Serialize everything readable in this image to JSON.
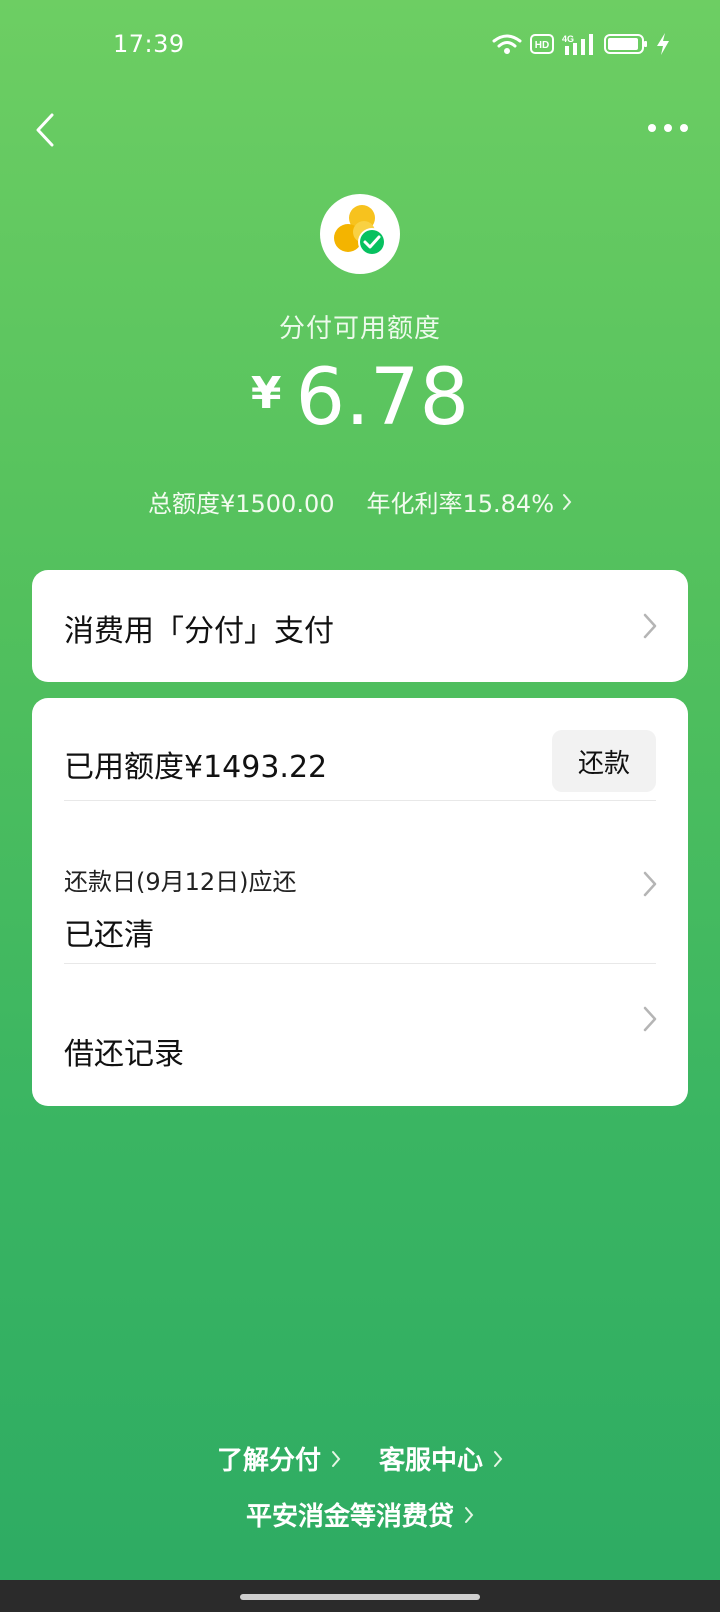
{
  "status_bar": {
    "time": "17:39",
    "icons": [
      "wifi-icon",
      "hd-icon",
      "signal-4g-icon",
      "battery-icon",
      "charging-icon"
    ]
  },
  "topbar": {
    "back_icon": "chevron-left-icon",
    "more_icon": "more-dots-icon"
  },
  "header": {
    "logo": "fenfu-logo",
    "credit_label": "分付可用额度",
    "currency_symbol": "¥",
    "available_amount": "6.78",
    "total_limit": "总额度¥1500.00",
    "annual_rate": "年化利率15.84%"
  },
  "pay_card": {
    "label": "消费用「分付」支付"
  },
  "main_card": {
    "used_amount": "已用额度¥1493.22",
    "repay_button": "还款",
    "due_title": "还款日(9月12日)应还",
    "due_status": "已还清",
    "records_label": "借还记录"
  },
  "footer": {
    "learn_link": "了解分付",
    "service_link": "客服中心",
    "loan_link": "平安消金等消费贷"
  },
  "colors": {
    "gradient_top": "#6dce63",
    "gradient_bottom": "#2dab63",
    "logo_yellow": "#f7c21e",
    "check_green": "#07c160"
  }
}
